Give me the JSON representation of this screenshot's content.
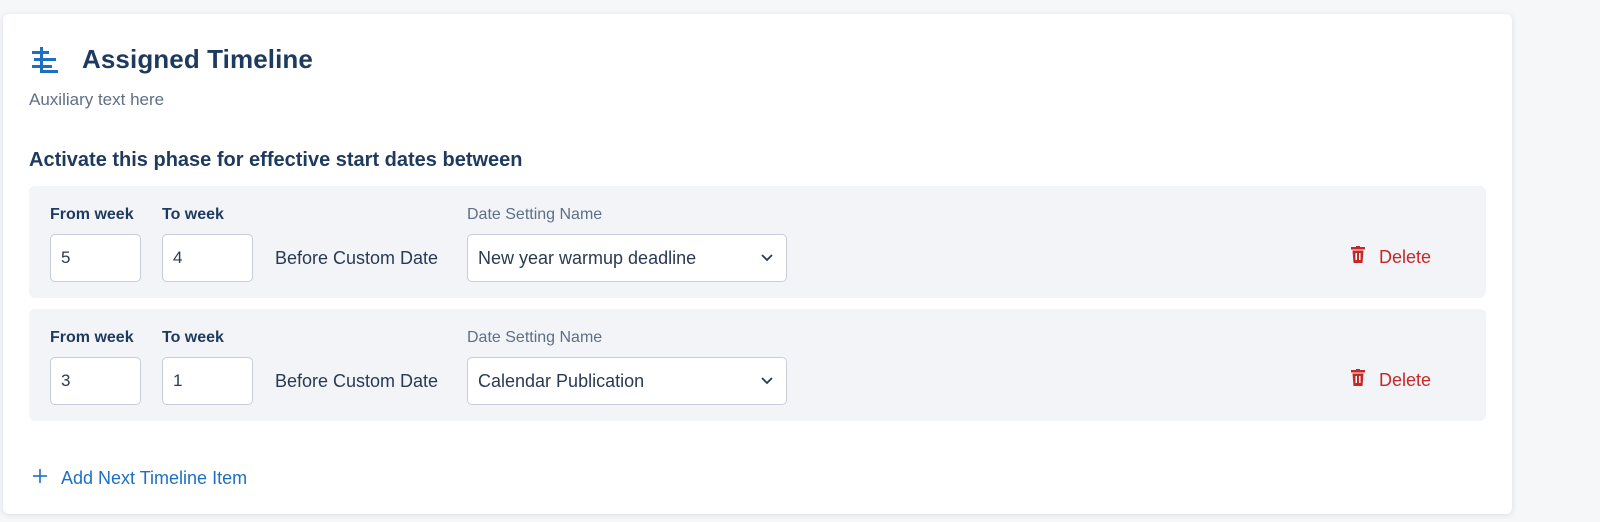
{
  "header": {
    "title": "Assigned Timeline",
    "subtitle": "Auxiliary text here",
    "icon": "timeline-icon"
  },
  "section": {
    "heading": "Activate this phase for effective start dates between"
  },
  "timeline_items": [
    {
      "from_label": "From week",
      "to_label": "To week",
      "from_value": "5",
      "to_value": "4",
      "relation_text": "Before Custom Date",
      "date_setting_label": "Date Setting Name",
      "date_setting_value": "New year warmup deadline",
      "delete_label": "Delete"
    },
    {
      "from_label": "From week",
      "to_label": "To week",
      "from_value": "3",
      "to_value": "1",
      "relation_text": "Before Custom Date",
      "date_setting_label": "Date Setting Name",
      "date_setting_value": "Calendar Publication",
      "delete_label": "Delete"
    }
  ],
  "add_item": {
    "label": "Add Next Timeline Item",
    "icon": "plus-icon"
  },
  "colors": {
    "accent": "#1d6fc4",
    "title": "#1f3a5f",
    "danger": "#c62828",
    "row_background": "#f2f4f8"
  }
}
